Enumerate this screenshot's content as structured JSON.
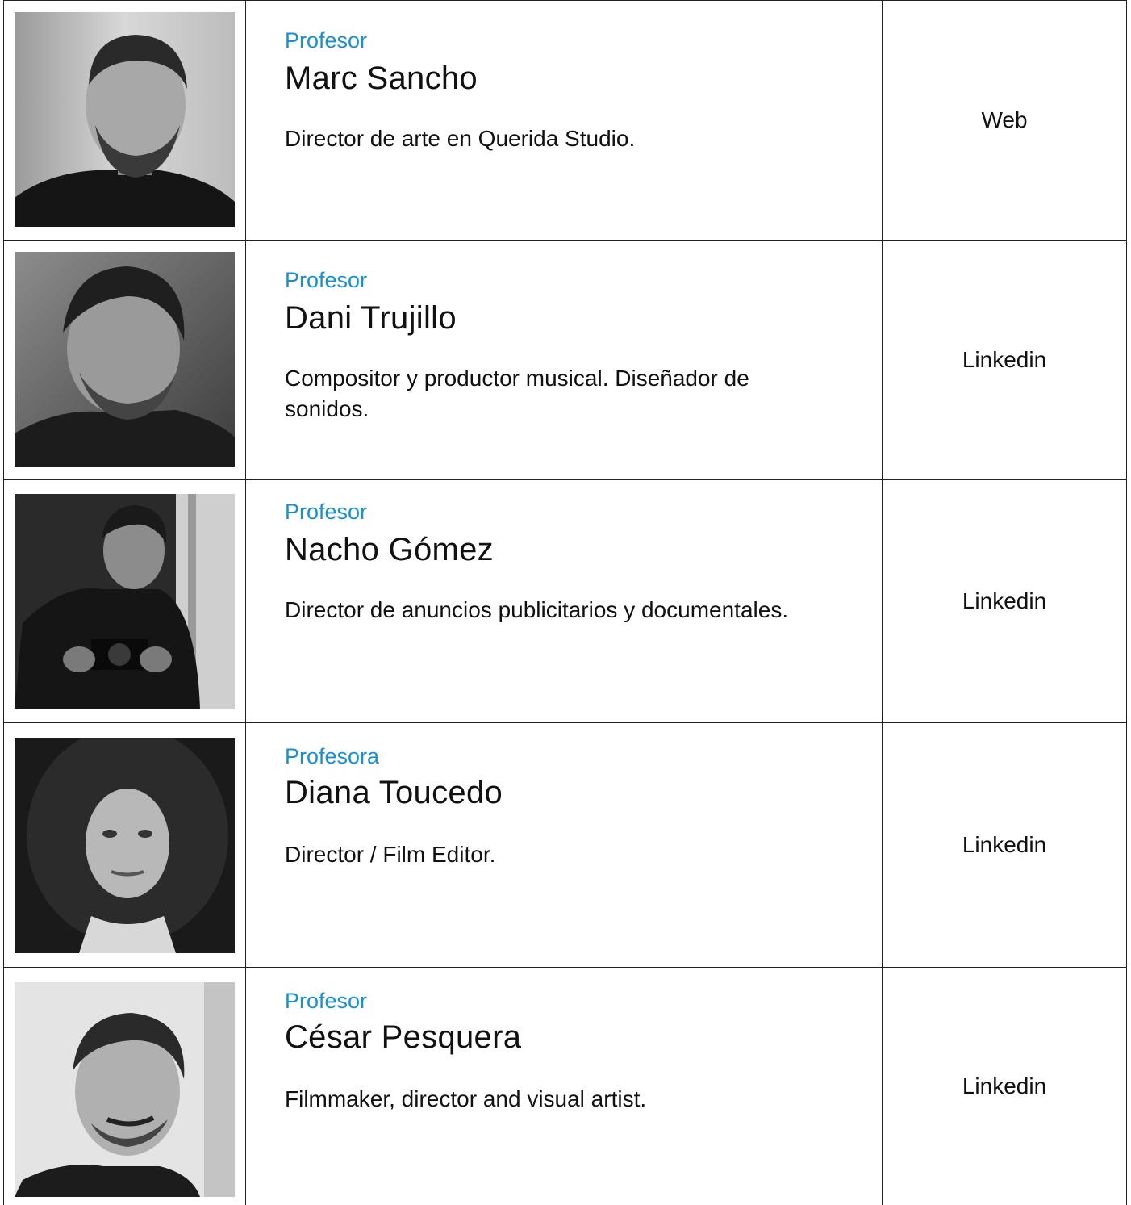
{
  "faculty": [
    {
      "role": "Profesor",
      "name": "Marc Sancho",
      "bio": "Director de arte en Querida Studio.",
      "link_label": "Web"
    },
    {
      "role": "Profesor",
      "name": "Dani Trujillo",
      "bio": "Compositor y productor musical. Diseñador de sonidos.",
      "link_label": "Linkedin"
    },
    {
      "role": "Profesor",
      "name": "Nacho Gómez",
      "bio": "Director de anuncios publicitarios y documentales.",
      "link_label": "Linkedin"
    },
    {
      "role": "Profesora",
      "name": "Diana Toucedo",
      "bio": "Director / Film Editor.",
      "link_label": "Linkedin"
    },
    {
      "role": "Profesor",
      "name": "César Pesquera",
      "bio": "Filmmaker, director and visual artist.",
      "link_label": "Linkedin"
    }
  ],
  "colors": {
    "role_accent": "#1591d6",
    "text": "#111111",
    "border": "#222222"
  }
}
